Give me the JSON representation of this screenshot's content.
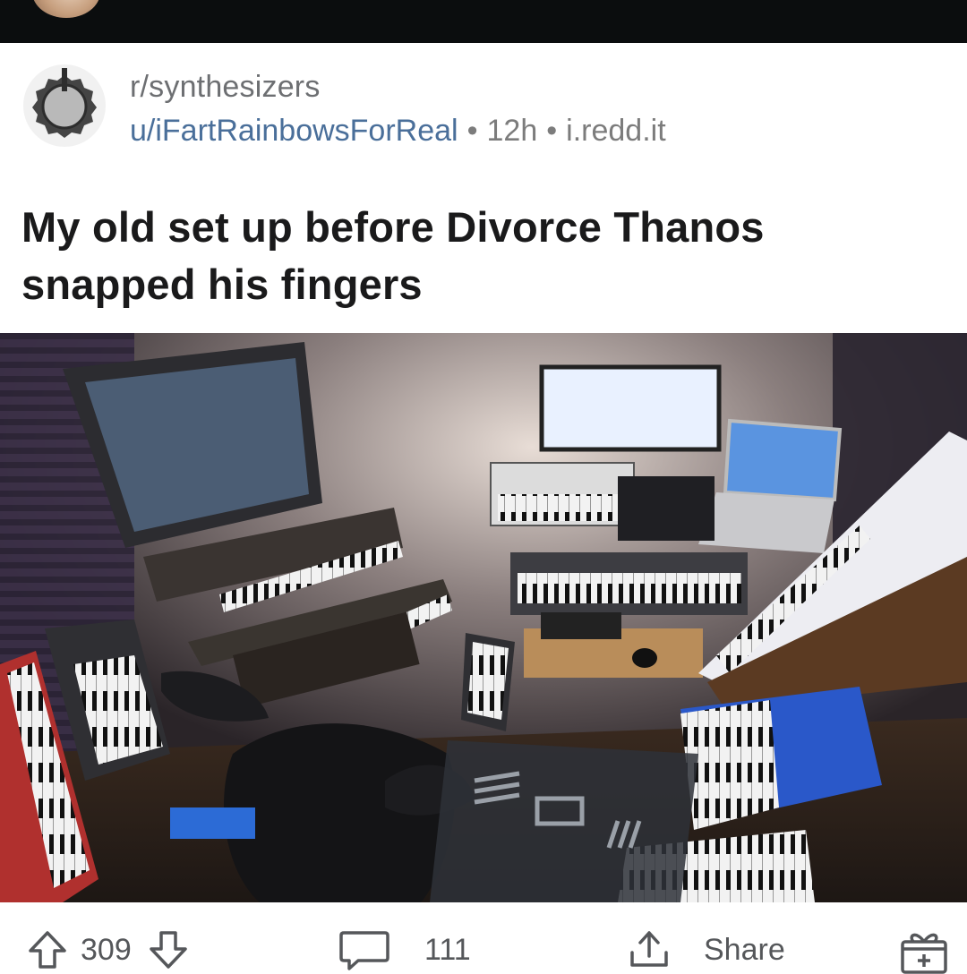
{
  "post": {
    "subreddit": "r/synthesizers",
    "author": "u/iFartRainbowsForReal",
    "age": "12h",
    "domain": "i.redd.it",
    "separator": "•",
    "title": "My old set up before Divorce Thanos snapped his fingers"
  },
  "actions": {
    "upvotes": "309",
    "comments": "111",
    "share_label": "Share"
  },
  "icons": {
    "subreddit": "synth-knob-icon",
    "upvote": "arrow-up-icon",
    "downvote": "arrow-down-icon",
    "comments": "comment-bubble-icon",
    "share": "share-icon",
    "award": "gift-icon"
  },
  "colors": {
    "topbar": "#0b0d0e",
    "author_link": "#4a6f9a",
    "meta_text": "#7c7c7c",
    "title_text": "#1a1a1b"
  }
}
